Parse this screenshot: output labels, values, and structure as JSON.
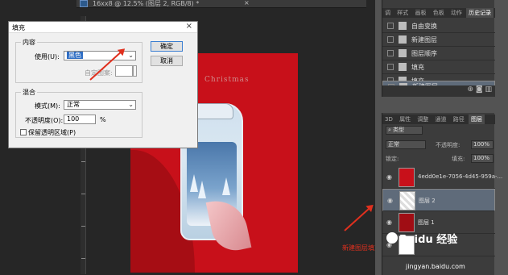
{
  "document": {
    "title": "16xx8 @ 12.5% (图层 2, RGB/8) *",
    "close_glyph": "×"
  },
  "artwork": {
    "title": "Christmas"
  },
  "dialog": {
    "title": "填充",
    "close_glyph": "×",
    "content_group": "内容",
    "use_label": "使用(U):",
    "use_value": "黑色",
    "custom_pattern_label": "自定图案:",
    "blend_group": "混合",
    "mode_label": "模式(M):",
    "mode_value": "正常",
    "opacity_label": "不透明度(O):",
    "opacity_value": "100",
    "opacity_unit": "%",
    "preserve_label": "保留透明区域(P)",
    "ok_label": "确定",
    "cancel_label": "取消"
  },
  "history_panel": {
    "tabs": [
      "调",
      "样式",
      "画板",
      "色板",
      "动作",
      "历史记录"
    ],
    "active_tab": "历史记录",
    "items": [
      {
        "label": "自由变换",
        "selected": false
      },
      {
        "label": "新建图层",
        "selected": false
      },
      {
        "label": "图层顺序",
        "selected": false
      },
      {
        "label": "填充",
        "selected": false
      },
      {
        "label": "填充",
        "selected": false
      },
      {
        "label": "新建图层",
        "selected": true
      }
    ]
  },
  "layers_panel": {
    "tabs": [
      "3D",
      "属性",
      "调整",
      "通道",
      "路径",
      "图层"
    ],
    "active_tab": "图层",
    "kind_filter": "类型",
    "blend_mode": "正常",
    "opacity_label": "不透明度:",
    "opacity_value": "100%",
    "lock_label": "锁定:",
    "fill_label": "填充:",
    "fill_value": "100%",
    "layers": [
      {
        "name": "4edd0e1e-7056-4d45-959a-...",
        "thumb": "image",
        "selected": false
      },
      {
        "name": "图层 2",
        "thumb": "transparent",
        "selected": true
      },
      {
        "name": "图层 1",
        "thumb": "red",
        "selected": false
      },
      {
        "name": "",
        "thumb": "white",
        "selected": false
      }
    ]
  },
  "annotation": {
    "text": "新建图层填充黑色"
  },
  "watermark": {
    "brand": "Baidu 经验",
    "url": "jingyan.baidu.com"
  },
  "colors": {
    "arrow": "#e0301e",
    "artboard": "#c8101a",
    "selection": "#5f6b7a"
  }
}
